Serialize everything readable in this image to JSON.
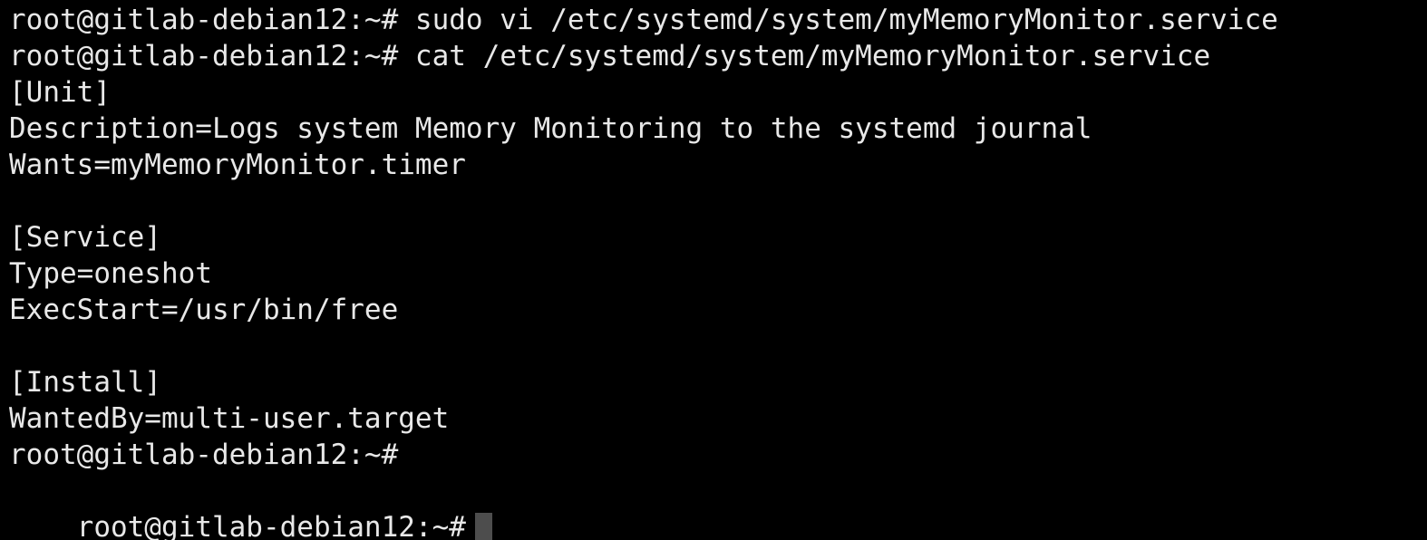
{
  "terminal": {
    "background_color": "#000000",
    "text_color": "#e8e8e8",
    "cursor_color": "#4d4d4d",
    "prompt": "root@gitlab-debian12:~#",
    "lines": [
      {
        "id": "cmd-vi",
        "text": "root@gitlab-debian12:~# sudo vi /etc/systemd/system/myMemoryMonitor.service"
      },
      {
        "id": "cmd-cat",
        "text": "root@gitlab-debian12:~# cat /etc/systemd/system/myMemoryMonitor.service"
      },
      {
        "id": "unit-header",
        "text": "[Unit]"
      },
      {
        "id": "unit-description",
        "text": "Description=Logs system Memory Monitoring to the systemd journal"
      },
      {
        "id": "unit-wants",
        "text": "Wants=myMemoryMonitor.timer"
      },
      {
        "id": "blank-1",
        "text": ""
      },
      {
        "id": "service-header",
        "text": "[Service]"
      },
      {
        "id": "service-type",
        "text": "Type=oneshot"
      },
      {
        "id": "service-execstart",
        "text": "ExecStart=/usr/bin/free"
      },
      {
        "id": "blank-2",
        "text": ""
      },
      {
        "id": "install-header",
        "text": "[Install]"
      },
      {
        "id": "install-wantedby",
        "text": "WantedBy=multi-user.target"
      },
      {
        "id": "prompt-idle",
        "text": "root@gitlab-debian12:~#"
      }
    ],
    "active_prompt": "root@gitlab-debian12:~#",
    "active_input": ""
  }
}
